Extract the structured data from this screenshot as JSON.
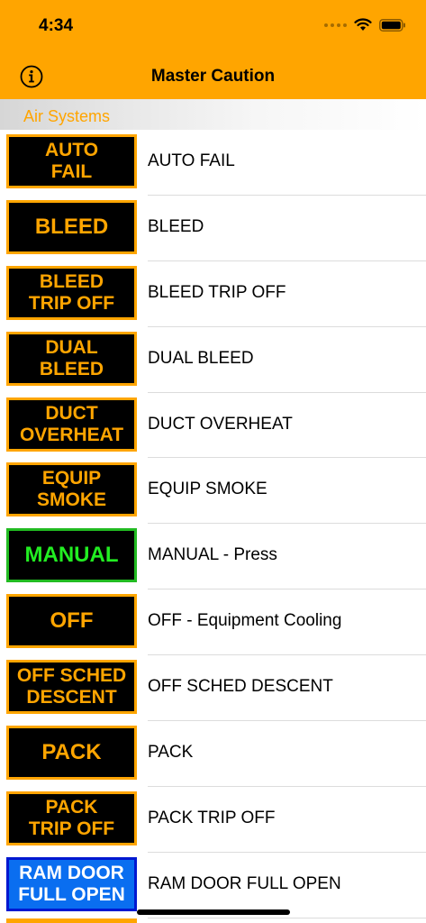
{
  "status_bar": {
    "time": "4:34"
  },
  "nav": {
    "title": "Master Caution",
    "info_icon": "info-icon"
  },
  "section": {
    "title": "Air Systems"
  },
  "colors": {
    "amber": "#FFA500",
    "green": "#22EE22",
    "blue": "#0A6EF0"
  },
  "items": [
    {
      "badge": "AUTO\nFAIL",
      "label": "AUTO FAIL"
    },
    {
      "badge": "BLEED",
      "label": "BLEED"
    },
    {
      "badge": "BLEED\nTRIP OFF",
      "label": "BLEED TRIP OFF"
    },
    {
      "badge": "DUAL\nBLEED",
      "label": "DUAL BLEED"
    },
    {
      "badge": "DUCT\nOVERHEAT",
      "label": "DUCT OVERHEAT"
    },
    {
      "badge": "EQUIP\nSMOKE",
      "label": "EQUIP SMOKE"
    },
    {
      "badge": "MANUAL",
      "label": "MANUAL - Press",
      "color": "green"
    },
    {
      "badge": "OFF",
      "label": "OFF - Equipment Cooling"
    },
    {
      "badge": "OFF SCHED\nDESCENT",
      "label": "OFF SCHED DESCENT"
    },
    {
      "badge": "PACK",
      "label": "PACK"
    },
    {
      "badge": "PACK\nTRIP OFF",
      "label": "PACK TRIP OFF"
    },
    {
      "badge": "RAM DOOR\nFULL OPEN",
      "label": "RAM DOOR FULL OPEN",
      "color": "blue"
    }
  ]
}
